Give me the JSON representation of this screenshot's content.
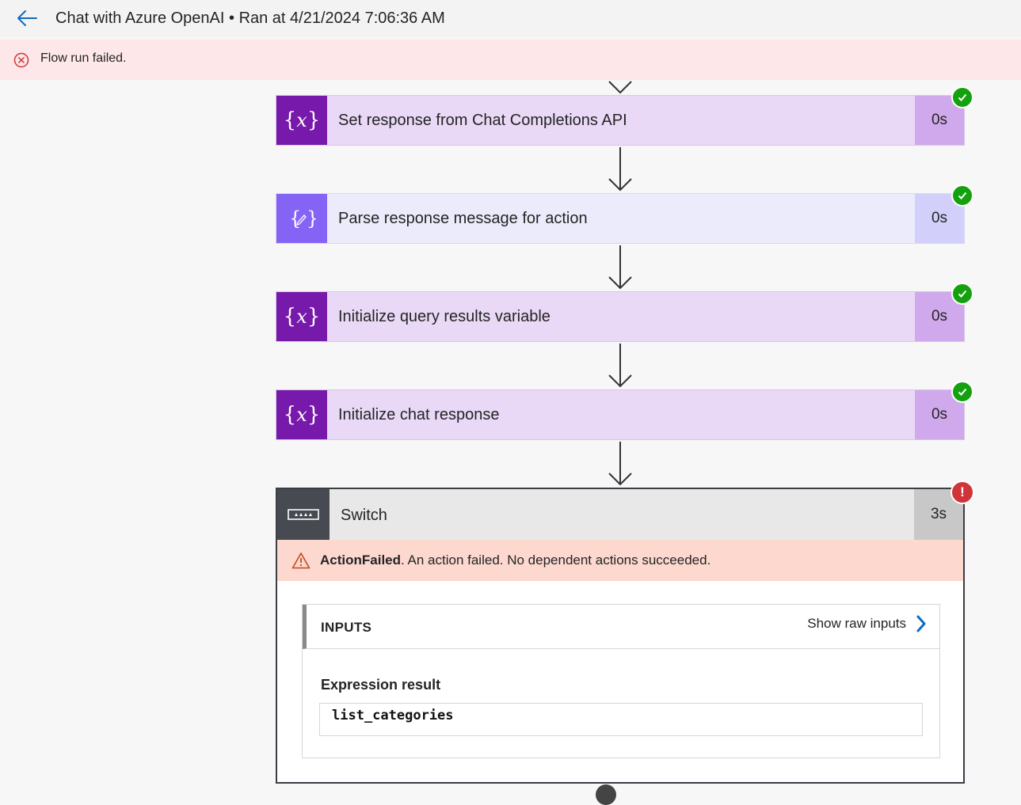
{
  "header": {
    "title": "Chat with Azure OpenAI • Ran at 4/21/2024 7:06:36 AM",
    "back_icon": "arrow-left-icon"
  },
  "banner": {
    "message": "Flow run failed.",
    "icon": "error-circle-icon",
    "color": "#d13438"
  },
  "steps": [
    {
      "label": "Set response from Chat Completions API",
      "duration": "0s",
      "icon": "variable-icon",
      "status": "succeeded"
    },
    {
      "label": "Parse response message for action",
      "duration": "0s",
      "icon": "data-operation-icon",
      "status": "succeeded"
    },
    {
      "label": "Initialize query results variable",
      "duration": "0s",
      "icon": "variable-icon",
      "status": "succeeded"
    },
    {
      "label": "Initialize chat response",
      "duration": "0s",
      "icon": "variable-icon",
      "status": "succeeded"
    }
  ],
  "switch": {
    "label": "Switch",
    "duration": "3s",
    "status": "failed",
    "error_code": "ActionFailed",
    "error_message": ". An action failed. No dependent actions succeeded.",
    "inputs_title": "INPUTS",
    "show_raw_label": "Show raw inputs",
    "expression_label": "Expression result",
    "expression_value": "list_categories"
  },
  "colors": {
    "variable_accent": "#7719aa",
    "parse_accent": "#8563f5",
    "success": "#13a10e",
    "error": "#d13438",
    "link": "#0f6cbd"
  }
}
